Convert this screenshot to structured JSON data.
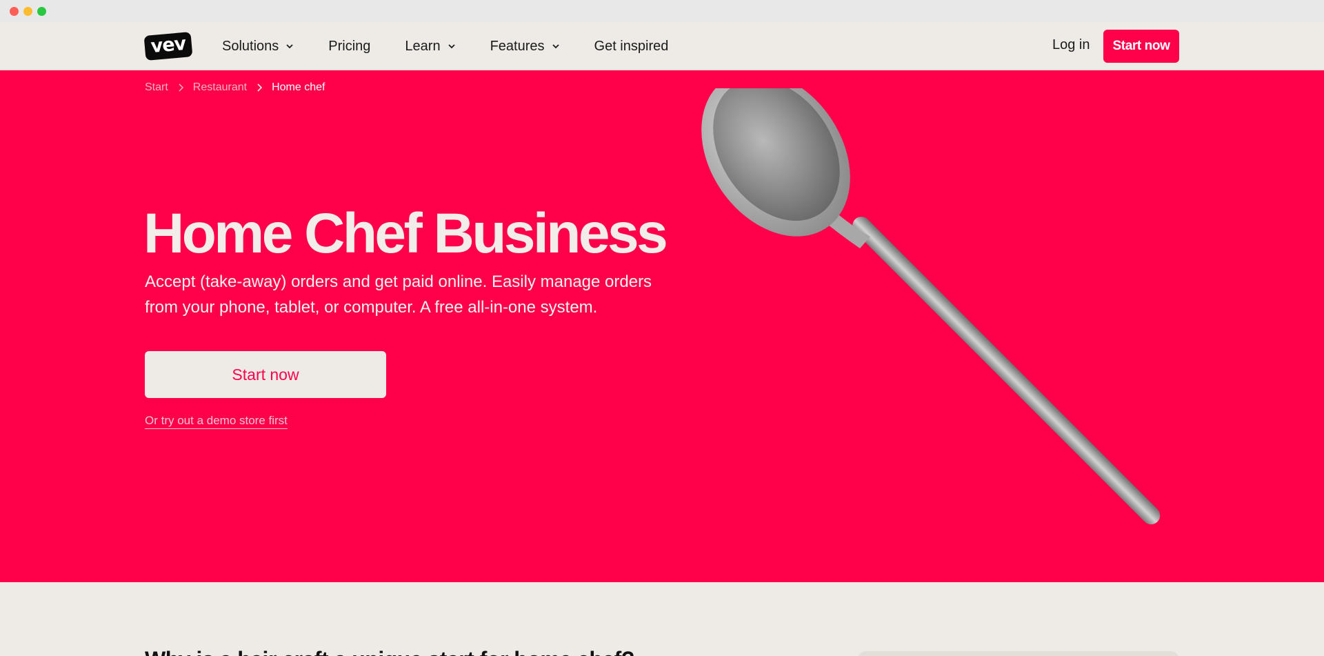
{
  "header": {
    "logo_text": "vev",
    "nav": [
      {
        "label": "Solutions",
        "dropdown": true
      },
      {
        "label": "Pricing",
        "dropdown": false
      },
      {
        "label": "Learn",
        "dropdown": true
      },
      {
        "label": "Features",
        "dropdown": true
      },
      {
        "label": "Get inspired",
        "dropdown": false
      }
    ],
    "login_label": "Log in",
    "cta_label": "Start now"
  },
  "breadcrumb": {
    "items": [
      "Start",
      "Restaurant",
      "Home chef"
    ]
  },
  "hero": {
    "title": "Home Chef Business",
    "subtitle": "Accept (take-away) orders and get paid online. Easily manage orders from your phone, tablet, or computer. A free all-in-one system.",
    "cta_label": "Start now",
    "demo_link": "Or try out a demo store first"
  },
  "below": {
    "heading": "Why is a hair craft a unique start for home chef?"
  },
  "colors": {
    "brand": "#ff004b",
    "background": "#eeebe6",
    "text": "#1a1a1a"
  },
  "icons": {
    "dropdown": "chevron-down-icon",
    "breadcrumb_sep": "chevron-right-icon",
    "hero_image": "wooden-spoon-image"
  }
}
